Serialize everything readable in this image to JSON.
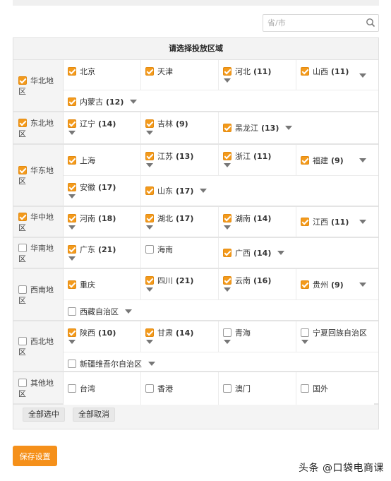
{
  "search": {
    "placeholder": "省/市"
  },
  "panel": {
    "title": "请选择投放区域"
  },
  "regions": [
    {
      "label": "华北地区",
      "checked": true,
      "height": 74,
      "rows": [
        {
          "height": 43,
          "cells": [
            {
              "name": "北京",
              "count": "",
              "checked": true,
              "arrow": "none"
            },
            {
              "name": "天津",
              "count": "",
              "checked": true,
              "arrow": "none"
            },
            {
              "name": "河北",
              "count": "(11)",
              "checked": true,
              "arrow": "below"
            },
            {
              "name": "山西",
              "count": "(11)",
              "checked": true,
              "arrow": "right"
            }
          ]
        },
        {
          "height": 29,
          "cells": [
            {
              "name": "内蒙古",
              "count": "(12)",
              "checked": true,
              "arrow": "inline",
              "wide": true
            }
          ]
        }
      ]
    },
    {
      "label": "东北地区",
      "checked": true,
      "height": 46,
      "rows": [
        {
          "height": 44,
          "cells": [
            {
              "name": "辽宁",
              "count": "(14)",
              "checked": true,
              "arrow": "below"
            },
            {
              "name": "吉林",
              "count": "(9)",
              "checked": true,
              "arrow": "below"
            },
            {
              "name": "黑龙江",
              "count": "(13)",
              "checked": true,
              "arrow": "inline",
              "wide": true,
              "mid": true
            }
          ]
        }
      ]
    },
    {
      "label": "华东地区",
      "checked": true,
      "height": 88,
      "rows": [
        {
          "height": 44,
          "cells": [
            {
              "name": "上海",
              "count": "",
              "checked": true,
              "arrow": "none",
              "mid": true
            },
            {
              "name": "江苏",
              "count": "(13)",
              "checked": true,
              "arrow": "below"
            },
            {
              "name": "浙江",
              "count": "(11)",
              "checked": true,
              "arrow": "below"
            },
            {
              "name": "福建",
              "count": "(9)",
              "checked": true,
              "arrow": "right",
              "mid": true
            }
          ]
        },
        {
          "height": 42,
          "cells": [
            {
              "name": "安徽",
              "count": "(17)",
              "checked": true,
              "arrow": "below"
            },
            {
              "name": "山东",
              "count": "(17)",
              "checked": true,
              "arrow": "inline",
              "wide": true,
              "mid": true
            }
          ]
        }
      ]
    },
    {
      "label": "华中地区",
      "checked": true,
      "height": 44,
      "rows": [
        {
          "height": 42,
          "cells": [
            {
              "name": "河南",
              "count": "(18)",
              "checked": true,
              "arrow": "below"
            },
            {
              "name": "湖北",
              "count": "(17)",
              "checked": true,
              "arrow": "below"
            },
            {
              "name": "湖南",
              "count": "(14)",
              "checked": true,
              "arrow": "below"
            },
            {
              "name": "江西",
              "count": "(11)",
              "checked": true,
              "arrow": "right",
              "mid": true
            }
          ]
        }
      ]
    },
    {
      "label": "华南地区",
      "checked": false,
      "height": 44,
      "rows": [
        {
          "height": 42,
          "cells": [
            {
              "name": "广东",
              "count": "(21)",
              "checked": true,
              "arrow": "below"
            },
            {
              "name": "海南",
              "count": "",
              "checked": false,
              "arrow": "none"
            },
            {
              "name": "广西",
              "count": "(14)",
              "checked": true,
              "arrow": "inline",
              "wide": true,
              "mid": true
            }
          ]
        }
      ]
    },
    {
      "label": "西南地区",
      "checked": false,
      "height": 74,
      "rows": [
        {
          "height": 44,
          "cells": [
            {
              "name": "重庆",
              "count": "",
              "checked": true,
              "arrow": "none",
              "mid": true
            },
            {
              "name": "四川",
              "count": "(21)",
              "checked": true,
              "arrow": "below"
            },
            {
              "name": "云南",
              "count": "(16)",
              "checked": true,
              "arrow": "below"
            },
            {
              "name": "贵州",
              "count": "(9)",
              "checked": true,
              "arrow": "right",
              "mid": true
            }
          ]
        },
        {
          "height": 28,
          "cells": [
            {
              "name": "西藏自治区",
              "count": "",
              "checked": false,
              "arrow": "inline",
              "wide": true
            }
          ]
        }
      ]
    },
    {
      "label": "西北地区",
      "checked": false,
      "height": 72,
      "rows": [
        {
          "height": 44,
          "cells": [
            {
              "name": "陕西",
              "count": "(10)",
              "checked": true,
              "arrow": "below"
            },
            {
              "name": "甘肃",
              "count": "(14)",
              "checked": true,
              "arrow": "below"
            },
            {
              "name": "青海",
              "count": "",
              "checked": false,
              "arrow": "below"
            },
            {
              "name": "宁夏回族自治区",
              "count": "",
              "checked": false,
              "arrow": "below"
            }
          ]
        },
        {
          "height": 26,
          "cells": [
            {
              "name": "新疆维吾尔自治区",
              "count": "",
              "checked": false,
              "arrow": "inline",
              "wide": true
            }
          ]
        }
      ]
    },
    {
      "label": "其他地区",
      "checked": false,
      "height": 46,
      "rows": [
        {
          "height": 46,
          "cells": [
            {
              "name": "台湾",
              "count": "",
              "checked": false,
              "arrow": "none",
              "mid": true
            },
            {
              "name": "香港",
              "count": "",
              "checked": false,
              "arrow": "none",
              "mid": true
            },
            {
              "name": "澳门",
              "count": "",
              "checked": false,
              "arrow": "none",
              "mid": true
            },
            {
              "name": "国外",
              "count": "",
              "checked": false,
              "arrow": "none",
              "mid": true
            }
          ]
        }
      ]
    }
  ],
  "footer": {
    "select_all": "全部选中",
    "deselect_all": "全部取消"
  },
  "save_button": "保存设置",
  "watermark": "头条 @口袋电商课",
  "colors": {
    "accent": "#f39a1c",
    "save": "#f5901a"
  },
  "icons": {
    "search": "search-icon",
    "dropdown": "caret-down-icon"
  }
}
